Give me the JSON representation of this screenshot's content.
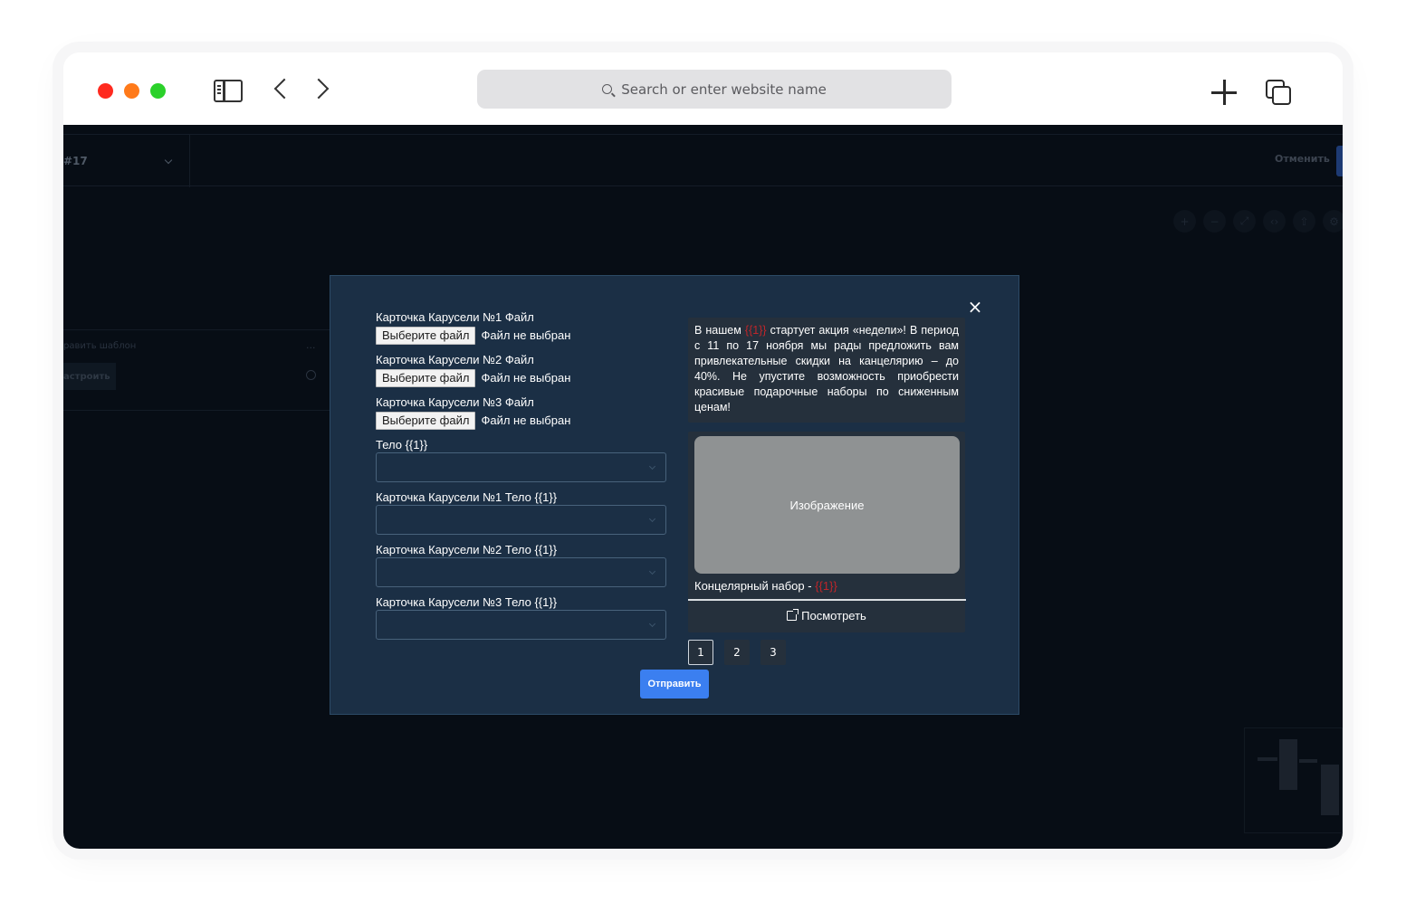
{
  "browser": {
    "address_placeholder": "Search or enter website name"
  },
  "app": {
    "flow_label": "#17",
    "cancel_label": "Отменить",
    "edit_template_label": "равить шаблон",
    "panel_menu": "...",
    "configure_label": "астроить"
  },
  "modal": {
    "file_fields": [
      {
        "label": "Карточка Карусели №1 Файл",
        "button": "Выберите файл",
        "status": "Файл не выбран"
      },
      {
        "label": "Карточка Карусели №2 Файл",
        "button": "Выберите файл",
        "status": "Файл не выбран"
      },
      {
        "label": "Карточка Карусели №3 Файл",
        "button": "Выберите файл",
        "status": "Файл не выбран"
      }
    ],
    "select_fields": [
      {
        "label": "Тело {{1}}"
      },
      {
        "label": "Карточка Карусели №1 Тело {{1}}"
      },
      {
        "label": "Карточка Карусели №2 Тело {{1}}"
      },
      {
        "label": "Карточка Карусели №3 Тело {{1}}"
      }
    ],
    "preview": {
      "message_part1": "В нашем ",
      "variable": "{{1}}",
      "message_part2": " стартует акция «недели»! В период с 11 по 17 ноября мы рады предложить вам привлекательные скидки на канцелярию – до 40%. Не упустите возможность приобрести красивые подарочные наборы по сниженным ценам!",
      "image_placeholder": "Изображение",
      "card_caption": "Концелярный набор - ",
      "card_variable": "{{1}}",
      "card_action": "Посмотреть"
    },
    "pages": [
      "1",
      "2",
      "3"
    ],
    "active_page": "1",
    "submit_label": "Отправить",
    "close_glyph": "×"
  },
  "colors": {
    "modal_bg": "#1b2f45",
    "variable": "#c0262a",
    "primary": "#3b7ff0"
  }
}
